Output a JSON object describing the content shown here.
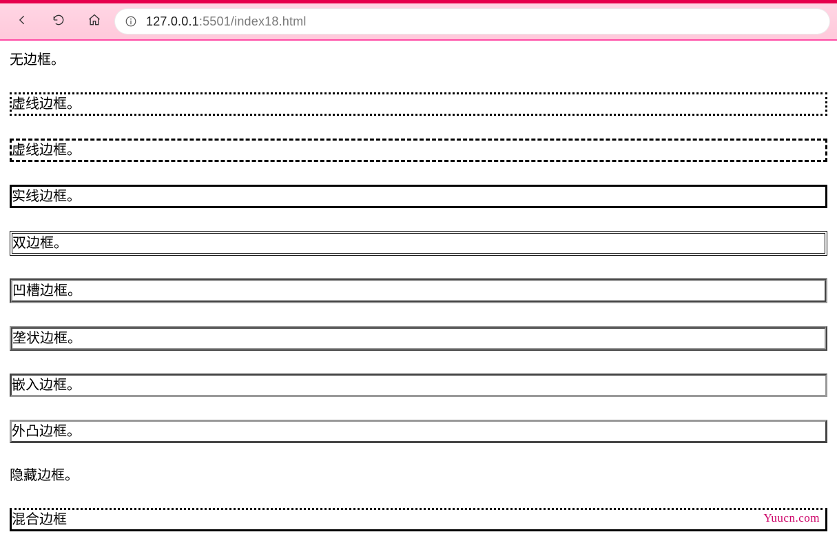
{
  "url": {
    "full": "127.0.0.1:5501/index18.html",
    "host": "127.0.0.1",
    "port_path": ":5501/index18.html"
  },
  "icons": {
    "back": "back-icon",
    "refresh": "refresh-icon",
    "home": "home-icon",
    "info": "info-icon"
  },
  "paragraphs": {
    "none": "无边框。",
    "dotted": "虚线边框。",
    "dashed": "虚线边框。",
    "solid": "实线边框。",
    "double": "双边框。",
    "groove": "凹槽边框。",
    "ridge": "垄状边框。",
    "inset": "嵌入边框。",
    "outset": "外凸边框。",
    "hidden": "隐藏边框。",
    "mixed": "混合边框"
  },
  "watermark": "Yuucn.com"
}
